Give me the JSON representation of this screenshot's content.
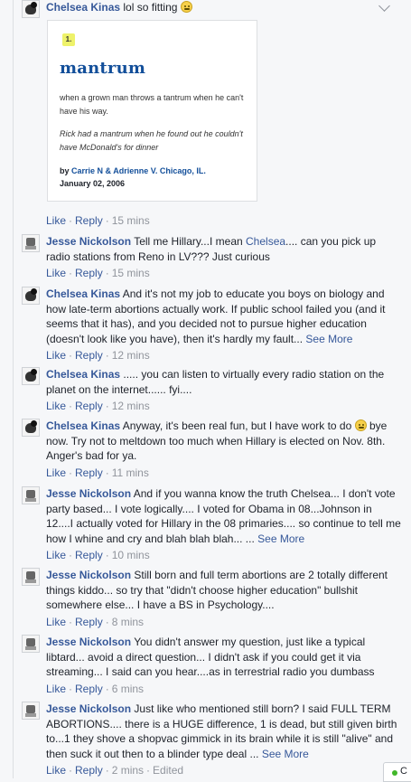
{
  "actions": {
    "like": "Like",
    "reply": "Reply",
    "sep": "·"
  },
  "comments": [
    {
      "author": "Chelsea Kinas",
      "text": "lol so fitting",
      "time": "15 mins",
      "card": {
        "number": "1.",
        "word": "mantrum",
        "definition": "when a grown man throws a tantrum when he can't have his way.",
        "example": "Rick had a mantrum when he found out he couldn't have McDonald's for dinner",
        "by": "by",
        "authors": "Carrie N & Adrienne V. Chicago, IL.",
        "date": "January 02, 2006"
      }
    },
    {
      "author": "Jesse Nickolson",
      "text_a": "Tell me Hillary...I mean",
      "mention": "Chelsea",
      "text_b": ".... can you pick up radio stations from Reno in LV??? Just curious",
      "time": "15 mins"
    },
    {
      "author": "Chelsea Kinas",
      "text": "And it's not my job to educate you boys on biology and how late-term abortions actually work. If public school failed you (and it seems that it has), and you decided not to pursue higher education (doesn't look like you have), then it's hardly my fault...",
      "see_more": "See More",
      "time": "12 mins"
    },
    {
      "author": "Chelsea Kinas",
      "text": "..... you can listen to virtually every radio station on the planet on the internet...... fyi....",
      "time": "12 mins"
    },
    {
      "author": "Chelsea Kinas",
      "text_a": "Anyway, it's been real fun, but I have work to do",
      "text_b": "bye now. Try not to meltdown too much when Hillary is elected on Nov. 8th. Anger's bad for ya.",
      "time": "11 mins"
    },
    {
      "author": "Jesse Nickolson",
      "text": "And if you wanna know the truth Chelsea... I don't vote party based... I vote logically.... I voted for Obama in 08...Johnson in 12....I actually voted for Hillary in the 08 primaries.... so continue to tell me how I whine and cry and blah blah blah... ...",
      "see_more": "See More",
      "time": "10 mins"
    },
    {
      "author": "Jesse Nickolson",
      "text": "Still born and full term abortions are 2 totally different things kiddo... so try that \"didn't choose higher education\" bullshit somewhere else... I have a BS in Psychology....",
      "time": "8 mins"
    },
    {
      "author": "Jesse Nickolson",
      "text": "You didn't answer my question, just like a typical libtard... avoid a direct question... I didn't ask if you could get it via streaming... I said can you hear....as in terrestrial radio you dumbass",
      "time": "6 mins"
    },
    {
      "author": "Jesse Nickolson",
      "text": "Just like who mentioned still born? I said FULL TERM ABORTIONS.... there is a HUGE difference, 1 is dead, but still given birth to...1 they shove a shopvac gimmick in its brain while it is still \"alive\" and then suck it out then to a blinder type deal ...",
      "see_more": "See More",
      "time": "2 mins",
      "edited": "Edited"
    }
  ],
  "chat": {
    "label": "C"
  }
}
